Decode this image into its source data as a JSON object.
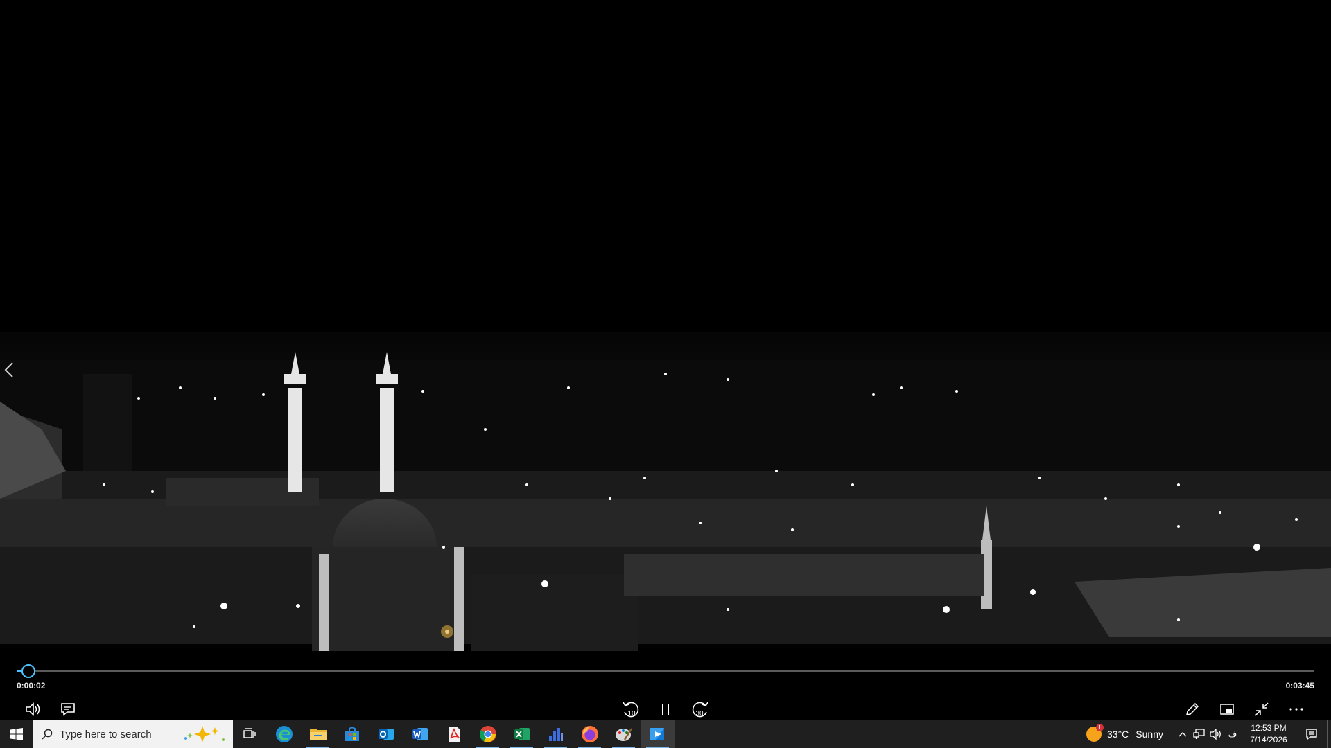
{
  "player": {
    "elapsed": "0:00:02",
    "total": "0:03:45",
    "progress_fraction": 0.009,
    "accent_color": "#4cc2ff",
    "skip_back_seconds": "10",
    "skip_forward_seconds": "30",
    "left_controls": [
      "volume-icon",
      "captions-icon"
    ],
    "center_controls": [
      "skip-back-10-icon",
      "pause-icon",
      "skip-forward-30-icon"
    ],
    "right_controls": [
      "edit-pencil-icon",
      "mini-view-icon",
      "exit-fullscreen-icon",
      "more-options-icon"
    ],
    "prev_arrow_icon": "chevron-left-icon"
  },
  "taskbar": {
    "search_placeholder": "Type here to search",
    "apps": [
      "task-view-icon",
      "edge-icon",
      "file-explorer-icon",
      "microsoft-store-icon",
      "outlook-icon",
      "word-icon",
      "acrobat-icon",
      "chrome-icon",
      "excel-icon",
      "analytics-icon",
      "firefox-icon",
      "paint-icon",
      "media-player-icon"
    ],
    "weather": {
      "temperature": "33°C",
      "condition": "Sunny",
      "badge": "1"
    },
    "tray_icons": [
      "chevron-up-icon",
      "network-icon",
      "speaker-icon",
      "language-icon"
    ],
    "language_label": "ف",
    "clock": {
      "time": "12:53 PM",
      "date": "7/14/2026"
    }
  }
}
